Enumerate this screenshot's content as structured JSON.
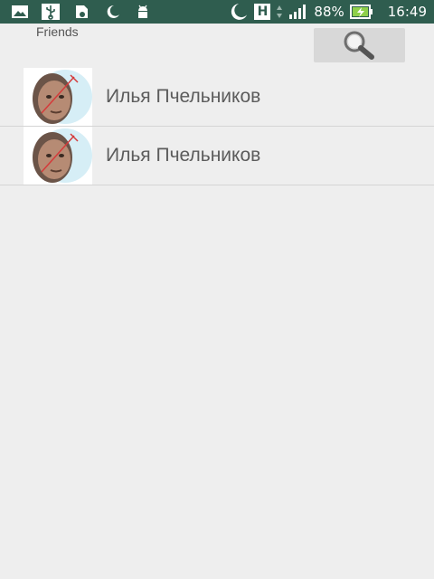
{
  "status_bar": {
    "battery_percent": "88%",
    "time": "16:49",
    "network_type": "H",
    "icons": [
      "image-icon",
      "usb-icon",
      "sd-card-icon",
      "moon-icon",
      "android-icon",
      "moon-icon",
      "network-arrows-icon",
      "signal-icon",
      "battery-charging-icon"
    ]
  },
  "header": {
    "title": "Friends",
    "search_icon": "search-icon"
  },
  "friends": [
    {
      "name": "Илья Пчельников",
      "avatar": "avatar-photo"
    },
    {
      "name": "Илья Пчельников",
      "avatar": "avatar-photo"
    }
  ],
  "colors": {
    "status_bar_bg": "#2f5d4f",
    "background": "#eeeeee",
    "search_button_bg": "#d8d8d8",
    "name_text": "#5c5c5c"
  }
}
